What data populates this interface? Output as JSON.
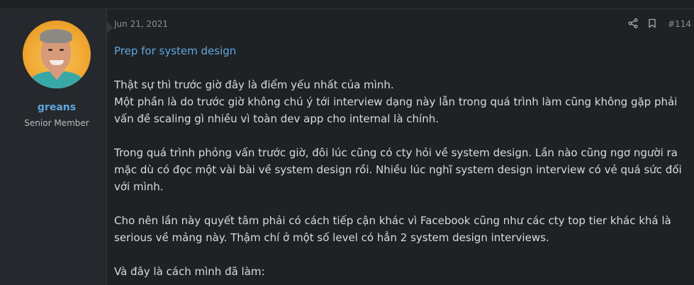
{
  "user": {
    "name": "greans",
    "title": "Senior Member"
  },
  "post": {
    "date": "Jun 21, 2021",
    "number": "#114",
    "title": "Prep for system design",
    "paragraphs": [
      "Thật sự thì trước giờ đây là điểm yếu nhất của mình.\nMột phần là do trước giờ không chú ý tới interview dạng này lẫn trong quá trình làm cũng không gặp phải vấn đề scaling gì nhiều vì toàn dev app cho internal là chính.",
      "Trong quá trình phỏng vấn trước giờ, đôi lúc cũng có cty hỏi về system design. Lần nào cũng ngơ người ra mặc dù có đọc một vài bài về system design rồi. Nhiều lúc nghĩ system design interview có vẻ quá sức đối với mình.",
      "Cho nên lần này quyết tâm phải có cách tiếp cận khác vì Facebook cũng như các cty top tier khác khá là serious về mảng này. Thậm chí ở một số level có hẳn 2 system design interviews.",
      "Và đây là cách mình đã làm:"
    ]
  },
  "icons": {
    "share": "share-icon",
    "bookmark": "bookmark-icon"
  },
  "colors": {
    "background": "#1f2225",
    "user_cell": "#25282c",
    "link": "#5ea8e0",
    "text": "#d9dbdd",
    "muted": "#8a8f95"
  }
}
